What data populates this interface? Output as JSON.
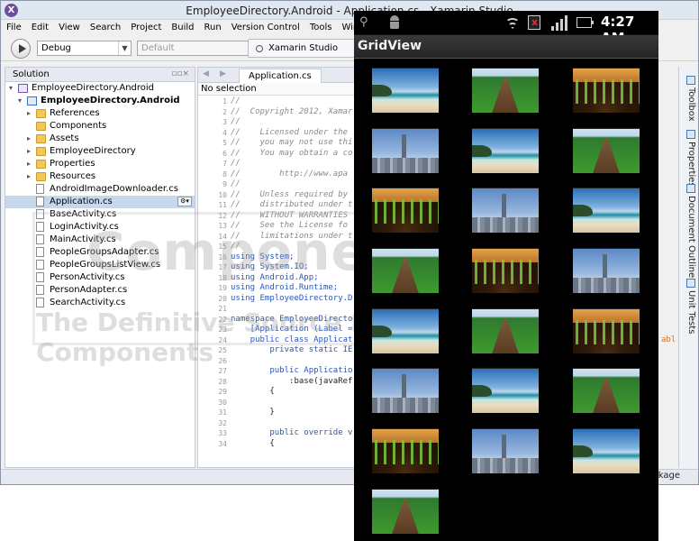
{
  "ide": {
    "window_title": "EmployeeDirectory.Android - Application.cs - Xamarin Studio",
    "menu": [
      "File",
      "Edit",
      "View",
      "Search",
      "Project",
      "Build",
      "Run",
      "Version Control",
      "Tools",
      "Window",
      "Help"
    ],
    "toolbar": {
      "configuration": "Debug",
      "platform_placeholder": "Default",
      "status": "Xamarin Studio"
    },
    "solution_pad": {
      "title": "Solution",
      "tree": [
        {
          "label": "EmployeeDirectory.Android",
          "type": "solution",
          "level": 0,
          "expander": "▾"
        },
        {
          "label": "EmployeeDirectory.Android",
          "type": "project",
          "level": 1,
          "expander": "▾"
        },
        {
          "label": "References",
          "type": "folder",
          "level": 2,
          "expander": "▸"
        },
        {
          "label": "Components",
          "type": "folder",
          "level": 2,
          "expander": ""
        },
        {
          "label": "Assets",
          "type": "folder",
          "level": 2,
          "expander": "▸"
        },
        {
          "label": "EmployeeDirectory",
          "type": "folder",
          "level": 2,
          "expander": "▸"
        },
        {
          "label": "Properties",
          "type": "folder",
          "level": 2,
          "expander": "▸"
        },
        {
          "label": "Resources",
          "type": "folder",
          "level": 2,
          "expander": "▸"
        },
        {
          "label": "AndroidImageDownloader.cs",
          "type": "file",
          "level": 2,
          "expander": ""
        },
        {
          "label": "Application.cs",
          "type": "file",
          "level": 2,
          "expander": "",
          "selected": true
        },
        {
          "label": "BaseActivity.cs",
          "type": "file",
          "level": 2,
          "expander": ""
        },
        {
          "label": "LoginActivity.cs",
          "type": "file",
          "level": 2,
          "expander": ""
        },
        {
          "label": "MainActivity.cs",
          "type": "file",
          "level": 2,
          "expander": ""
        },
        {
          "label": "PeopleGroupsAdapter.cs",
          "type": "file",
          "level": 2,
          "expander": ""
        },
        {
          "label": "PeopleGroupsListView.cs",
          "type": "file",
          "level": 2,
          "expander": ""
        },
        {
          "label": "PersonActivity.cs",
          "type": "file",
          "level": 2,
          "expander": ""
        },
        {
          "label": "PersonAdapter.cs",
          "type": "file",
          "level": 2,
          "expander": ""
        },
        {
          "label": "SearchActivity.cs",
          "type": "file",
          "level": 2,
          "expander": ""
        }
      ]
    },
    "editor": {
      "tab": "Application.cs",
      "selection": "No selection",
      "lines": [
        {
          "n": "1",
          "text": "//",
          "style": "comment"
        },
        {
          "n": "2",
          "text": "//  Copyright 2012, Xamar",
          "style": "comment"
        },
        {
          "n": "3",
          "text": "//",
          "style": "comment"
        },
        {
          "n": "4",
          "text": "//    Licensed under the",
          "style": "comment"
        },
        {
          "n": "5",
          "text": "//    you may not use thi",
          "style": "comment"
        },
        {
          "n": "6",
          "text": "//    You may obtain a co",
          "style": "comment"
        },
        {
          "n": "7",
          "text": "//",
          "style": "comment"
        },
        {
          "n": "8",
          "text": "//        http://www.apa",
          "style": "comment"
        },
        {
          "n": "9",
          "text": "//",
          "style": "comment"
        },
        {
          "n": "10",
          "text": "//    Unless required by",
          "style": "comment"
        },
        {
          "n": "11",
          "text": "//    distributed under t",
          "style": "comment"
        },
        {
          "n": "12",
          "text": "//    WITHOUT WARRANTIES",
          "style": "comment"
        },
        {
          "n": "13",
          "text": "//    See the License fo",
          "style": "comment"
        },
        {
          "n": "14",
          "text": "//    limitations under t",
          "style": "comment"
        },
        {
          "n": "15",
          "text": "//",
          "style": "comment"
        },
        {
          "n": "16",
          "text": "using System;",
          "style": "using"
        },
        {
          "n": "17",
          "text": "using System.IO;",
          "style": "using"
        },
        {
          "n": "18",
          "text": "using Android.App;",
          "style": "using"
        },
        {
          "n": "19",
          "text": "using Android.Runtime;",
          "style": "using"
        },
        {
          "n": "20",
          "text": "using EmployeeDirectory.D",
          "style": "using"
        },
        {
          "n": "21",
          "text": "",
          "style": "plain"
        },
        {
          "n": "22",
          "text": "namespace EmployeeDirecto",
          "style": "namespace"
        },
        {
          "n": "23",
          "text": "    [Application (Label =",
          "style": "kwline"
        },
        {
          "n": "24",
          "text": "    public class Applicat",
          "style": "kwline"
        },
        {
          "n": "25",
          "text": "        private static IE",
          "style": "kwline"
        },
        {
          "n": "26",
          "text": "",
          "style": "plain"
        },
        {
          "n": "27",
          "text": "        public Applicatio",
          "style": "kwline"
        },
        {
          "n": "28",
          "text": "            :base(javaRef",
          "style": "plain"
        },
        {
          "n": "29",
          "text": "        {",
          "style": "plain"
        },
        {
          "n": "30",
          "text": "",
          "style": "plain"
        },
        {
          "n": "31",
          "text": "        }",
          "style": "plain"
        },
        {
          "n": "32",
          "text": "",
          "style": "plain"
        },
        {
          "n": "33",
          "text": "        public override v",
          "style": "kwline"
        },
        {
          "n": "34",
          "text": "        {",
          "style": "plain"
        }
      ],
      "truncated_right_text": "abl"
    },
    "right_pads": [
      "Toolbox",
      "Properties",
      "Document Outline",
      "Unit Tests"
    ],
    "status_bar_text": "ackage",
    "colors": {
      "accent": "#2a55b8",
      "comment": "#8a8a8a",
      "selection": "#c8d8ec"
    }
  },
  "watermark": {
    "line1": "ComponentSource",
    "line2": "The Definitive Source for Software Components"
  },
  "android": {
    "clock": "4:27 AM",
    "app_title": "GridView",
    "status_icons": [
      "usb-icon",
      "android-debug-icon",
      "wifi-icon",
      "no-sim-icon",
      "signal-icon",
      "battery-icon"
    ],
    "grid": {
      "columns": 3,
      "cells": [
        "beach",
        "field",
        "sprout",
        "city",
        "beach",
        "field",
        "sprout",
        "city",
        "beach",
        "field",
        "sprout",
        "city",
        "beach",
        "field",
        "sprout",
        "city",
        "beach",
        "field",
        "sprout",
        "city",
        "beach",
        "field"
      ]
    }
  }
}
